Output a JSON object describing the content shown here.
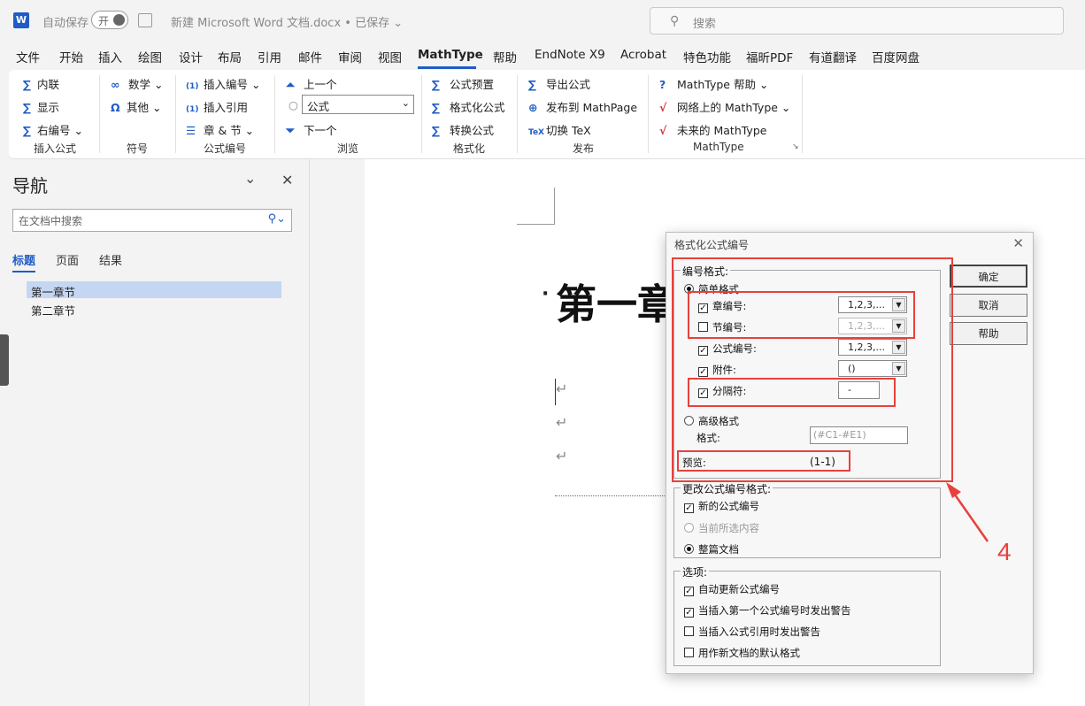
{
  "titlebar": {
    "logo": "W",
    "autosave_label": "自动保存",
    "autosave_state": "开",
    "doc_title": "新建 Microsoft Word 文档.docx • 已保存 ⌄",
    "search_placeholder": "搜索"
  },
  "menu": [
    "文件",
    "开始",
    "插入",
    "绘图",
    "设计",
    "布局",
    "引用",
    "邮件",
    "审阅",
    "视图",
    "MathType",
    "帮助",
    "EndNote X9",
    "Acrobat",
    "特色功能",
    "福昕PDF",
    "有道翻译",
    "百度网盘"
  ],
  "ribbon": {
    "insert": {
      "inline": "内联",
      "display": "显示",
      "right_num": "右编号",
      "group": "插入公式"
    },
    "symbols": {
      "math": "数学",
      "other": "其他",
      "group": "符号"
    },
    "numbering": {
      "insert_num": "插入编号",
      "insert_ref": "插入引用",
      "chapter": "章 & 节",
      "group": "公式编号"
    },
    "browse": {
      "prev": "上一个",
      "combo": "公式",
      "next": "下一个",
      "group": "浏览"
    },
    "format": {
      "preset": "公式预置",
      "format_eq": "格式化公式",
      "convert": "转换公式",
      "group": "格式化"
    },
    "publish": {
      "export": "导出公式",
      "mathpage": "发布到 MathPage",
      "tex": "切换 TeX",
      "group": "发布"
    },
    "mathtype": {
      "help": "MathType 帮助",
      "web": "网络上的 MathType",
      "future": "未来的 MathType",
      "group": "MathType"
    }
  },
  "nav": {
    "title": "导航",
    "search_placeholder": "在文档中搜索",
    "tabs": [
      "标题",
      "页面",
      "结果"
    ],
    "headings": [
      "第一章节",
      "第二章节"
    ]
  },
  "doc": {
    "heading": "第一章"
  },
  "dialog": {
    "title": "格式化公式编号",
    "numbering_legend": "编号格式:",
    "simple": "简单格式",
    "chapter_label": "章编号:",
    "chapter_value": "1,2,3,...",
    "section_label": "节编号:",
    "section_value": "1,2,3,...",
    "eq_label": "公式编号:",
    "eq_value": "1,2,3,...",
    "appendix_label": "附件:",
    "appendix_value": "()",
    "sep_label": "分隔符:",
    "sep_value": "-",
    "advanced": "高级格式",
    "format_label": "格式:",
    "format_value": "(#C1-#E1)",
    "preview_label": "预览:",
    "preview_value": "(1-1)",
    "change_legend": "更改公式编号格式:",
    "new_nums": "新的公式编号",
    "current_sel": "当前所选内容",
    "whole_doc": "整篇文档",
    "options_legend": "选项:",
    "opt1": "自动更新公式编号",
    "opt2": "当插入第一个公式编号时发出警告",
    "opt3": "当插入公式引用时发出警告",
    "opt4": "用作新文档的默认格式",
    "ok": "确定",
    "cancel": "取消",
    "help": "帮助"
  },
  "annotation": "4"
}
